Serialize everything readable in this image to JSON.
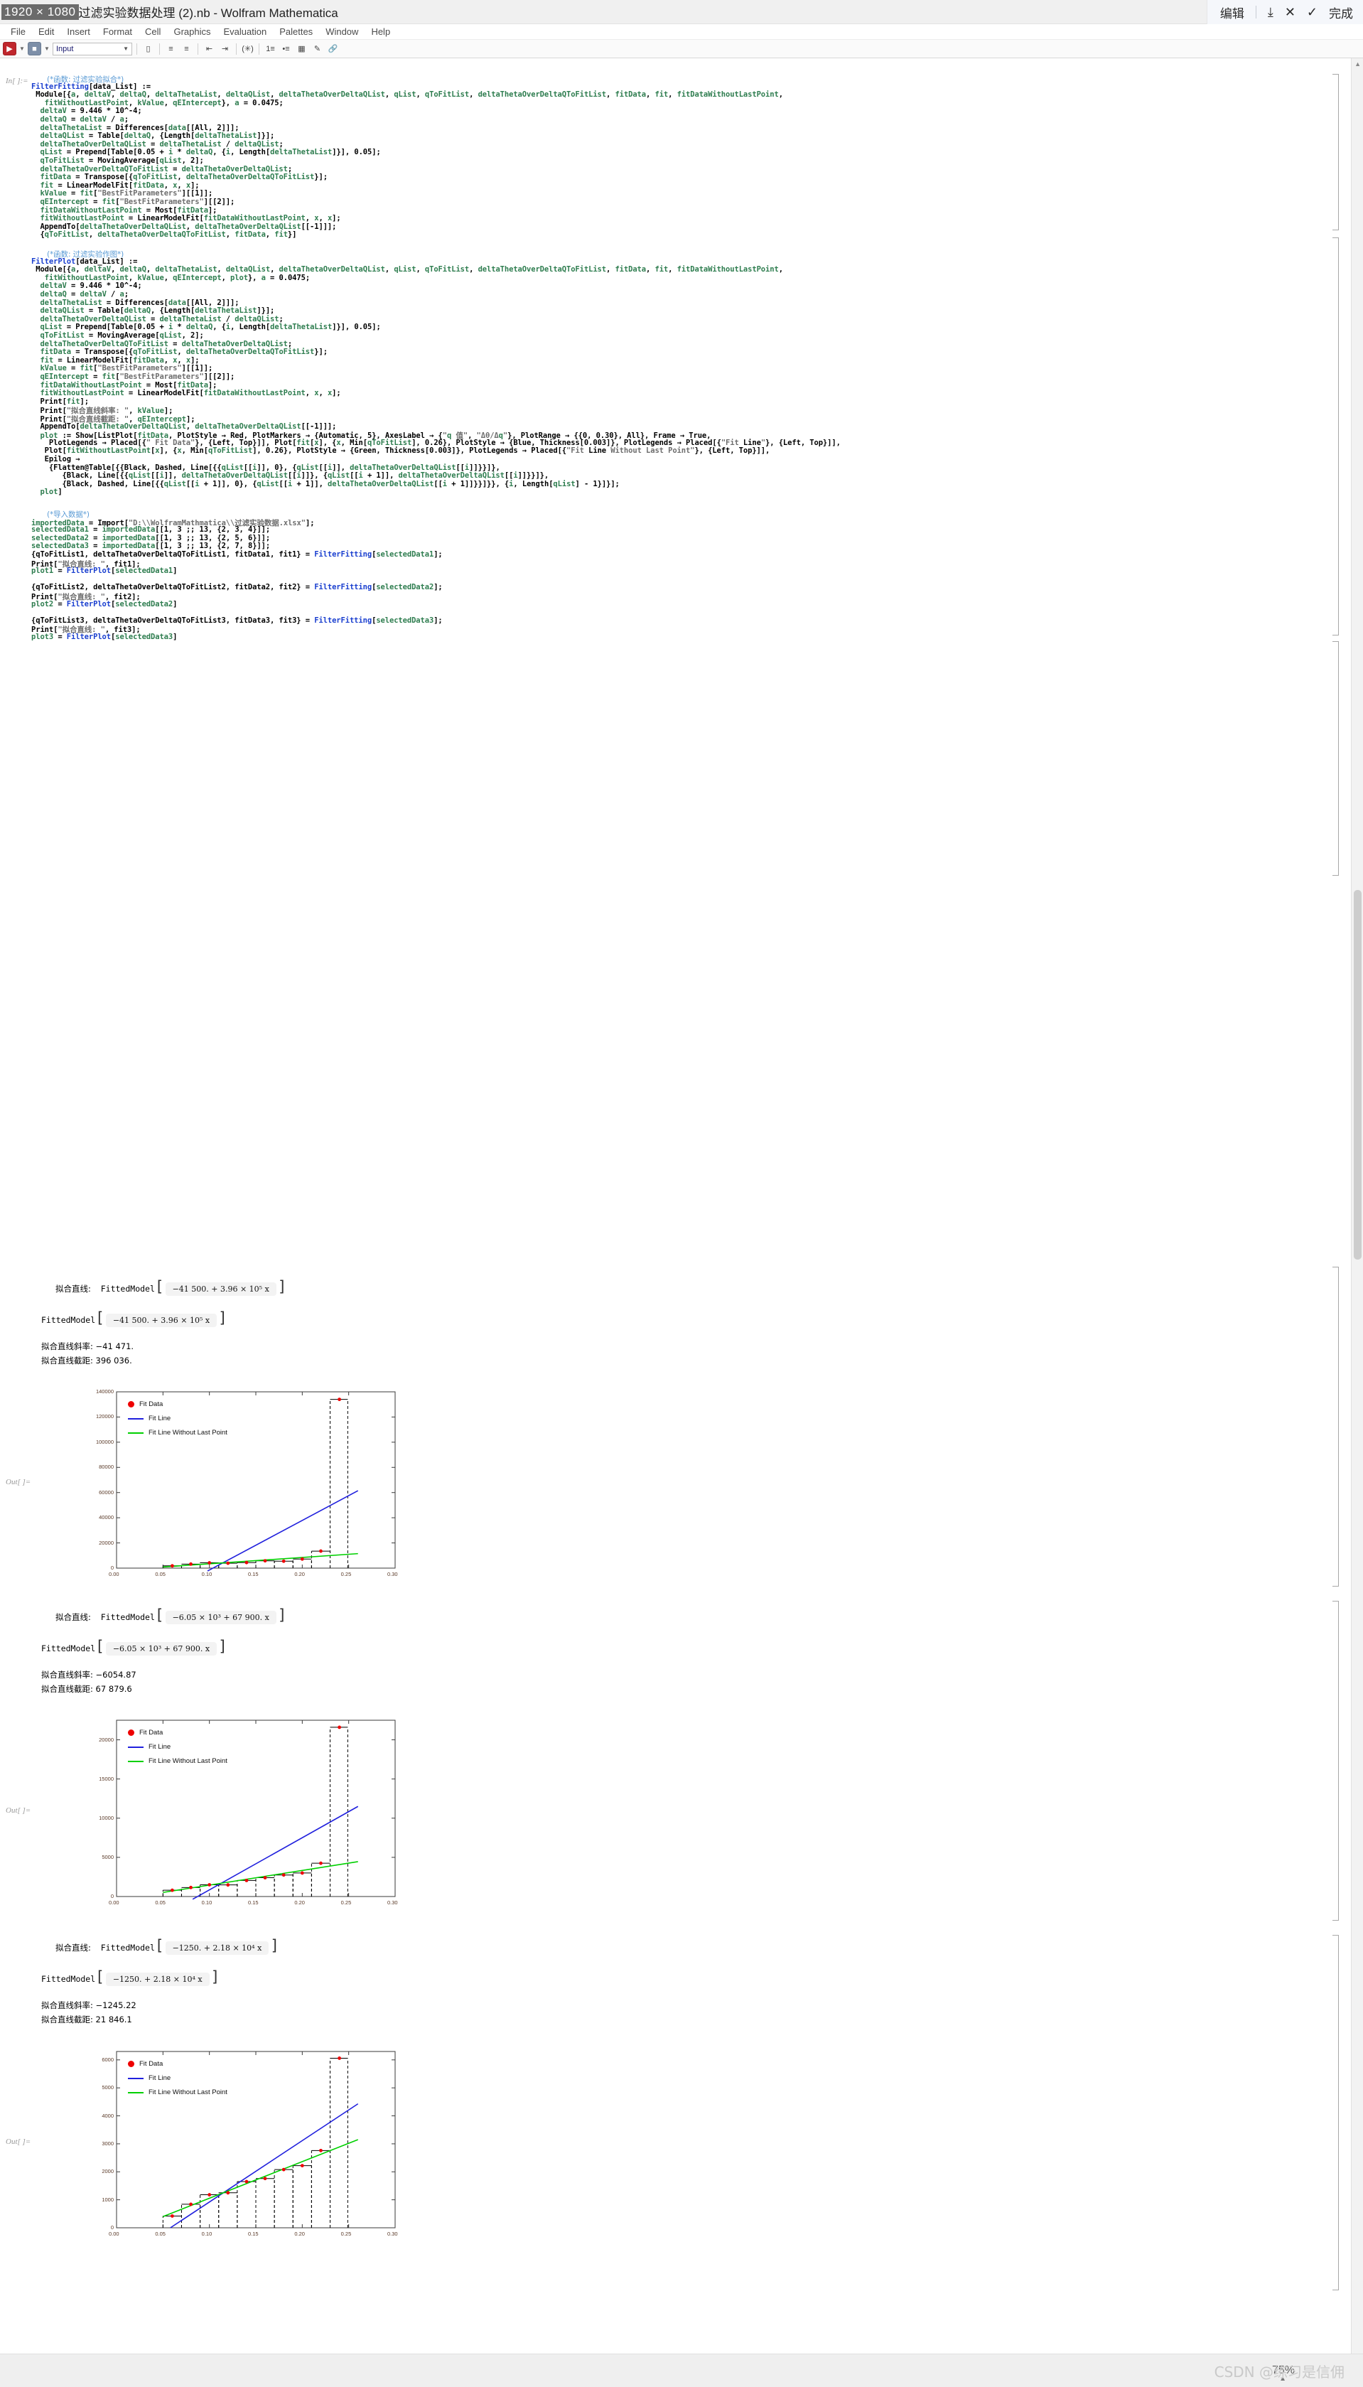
{
  "window": {
    "resolution_badge": "1920 × 1080",
    "title": "过滤实验数据处理 (2).nb - Wolfram Mathematica",
    "capture_toolbar": {
      "edit_label": "编辑",
      "save_icon": "download-icon",
      "cancel_icon": "close-x-icon",
      "check_icon": "check-icon",
      "done_label": "完成"
    }
  },
  "menubar": {
    "items": [
      {
        "label": "File",
        "accel": "F"
      },
      {
        "label": "Edit",
        "accel": "E"
      },
      {
        "label": "Insert",
        "accel": "I"
      },
      {
        "label": "Format",
        "accel": "o"
      },
      {
        "label": "Cell",
        "accel": "C"
      },
      {
        "label": "Graphics",
        "accel": "G"
      },
      {
        "label": "Evaluation",
        "accel": "v"
      },
      {
        "label": "Palettes",
        "accel": "P"
      },
      {
        "label": "Window",
        "accel": "W"
      },
      {
        "label": "Help",
        "accel": "H"
      }
    ]
  },
  "toolbar": {
    "style_value": "Input",
    "icons": [
      "run-button-icon",
      "chevron-down-icon",
      "settings-gear-icon",
      "chevron-down-icon",
      "cell-bracket-icon",
      "align-left-icon",
      "align-center-icon",
      "indent-decrease-icon",
      "indent-increase-icon",
      "math-input-icon",
      "text-format-icon",
      "bullet-list-icon",
      "numbered-list-icon",
      "color-swatch-icon",
      "pen-icon",
      "link-icon"
    ]
  },
  "notebook": {
    "cell1": {
      "in_label": "In[ ]:=",
      "comment": "(*函数: 过滤实验拟合*)",
      "lines": [
        "FilterFitting[data_List] :=",
        " Module[{a, deltaV, deltaQ, deltaThetaList, deltaQList, deltaThetaOverDeltaQList, qList, qToFitList, deltaThetaOverDeltaQToFitList, fitData, fit, fitDataWithoutLastPoint,",
        "   fitWithoutLastPoint, kValue, qEIntercept}, a = 0.0475;",
        "  deltaV = 9.446 * 10^-4;",
        "  deltaQ = deltaV / a;",
        "  deltaThetaList = Differences[data[[All, 2]]];",
        "  deltaQList = Table[deltaQ, {Length[deltaThetaList]}];",
        "  deltaThetaOverDeltaQList = deltaThetaList / deltaQList;",
        "  qList = Prepend[Table[0.05 + i * deltaQ, {i, Length[deltaThetaList]}], 0.05];",
        "  qToFitList = MovingAverage[qList, 2];",
        "  deltaThetaOverDeltaQToFitList = deltaThetaOverDeltaQList;",
        "  fitData = Transpose[{qToFitList, deltaThetaOverDeltaQToFitList}];",
        "  fit = LinearModelFit[fitData, x, x];",
        "  kValue = fit[\"BestFitParameters\"][[1]];",
        "  qEIntercept = fit[\"BestFitParameters\"][[2]];",
        "  fitDataWithoutLastPoint = Most[fitData];",
        "  fitWithoutLastPoint = LinearModelFit[fitDataWithoutLastPoint, x, x];",
        "  AppendTo[deltaThetaOverDeltaQList, deltaThetaOverDeltaQList[[-1]]];",
        "  {qToFitList, deltaThetaOverDeltaQToFitList, fitData, fit}]"
      ]
    },
    "cell2": {
      "comment": "(*函数: 过滤实验作图*)",
      "lines": [
        "FilterPlot[data_List] :=",
        " Module[{a, deltaV, deltaQ, deltaThetaList, deltaQList, deltaThetaOverDeltaQList, qList, qToFitList, deltaThetaOverDeltaQToFitList, fitData, fit, fitDataWithoutLastPoint,",
        "   fitWithoutLastPoint, kValue, qEIntercept, plot}, a = 0.0475;",
        "  deltaV = 9.446 * 10^-4;",
        "  deltaQ = deltaV / a;",
        "  deltaThetaList = Differences[data[[All, 2]]];",
        "  deltaQList = Table[deltaQ, {Length[deltaThetaList]}];",
        "  deltaThetaOverDeltaQList = deltaThetaList / deltaQList;",
        "  qList = Prepend[Table[0.05 + i * deltaQ, {i, Length[deltaThetaList]}], 0.05];",
        "  qToFitList = MovingAverage[qList, 2];",
        "  deltaThetaOverDeltaQToFitList = deltaThetaOverDeltaQList;",
        "  fitData = Transpose[{qToFitList, deltaThetaOverDeltaQToFitList}];",
        "  fit = LinearModelFit[fitData, x, x];",
        "  kValue = fit[\"BestFitParameters\"][[1]];",
        "  qEIntercept = fit[\"BestFitParameters\"][[2]];",
        "  fitDataWithoutLastPoint = Most[fitData];",
        "  fitWithoutLastPoint = LinearModelFit[fitDataWithoutLastPoint, x, x];",
        "  Print[fit];",
        "  Print[\"拟合直线斜率: \", kValue];",
        "  Print[\"拟合直线截距: \", qEIntercept];",
        "  AppendTo[deltaThetaOverDeltaQList, deltaThetaOverDeltaQList[[-1]]];",
        "  plot := Show[ListPlot[fitData, PlotStyle → Red, PlotMarkers → {Automatic, 5}, AxesLabel → {\"q 值\", \"Δθ/Δq\"}, PlotRange → {{0, 0.30}, All}, Frame → True,",
        "    PlotLegends → Placed[{\" Fit Data\"}, {Left, Top}]], Plot[fit[x], {x, Min[qToFitList], 0.26}, PlotStyle → {Blue, Thickness[0.003]}, PlotLegends → Placed[{\"Fit Line\"}, {Left, Top}]],",
        "   Plot[fitWithoutLastPoint[x], {x, Min[qToFitList], 0.26}, PlotStyle → {Green, Thickness[0.003]}, PlotLegends → Placed[{\"Fit Line Without Last Point\"}, {Left, Top}]],",
        "   Epilog →",
        "    {Flatten@Table[{{Black, Dashed, Line[{{qList[[i]], 0}, {qList[[i]], deltaThetaOverDeltaQList[[i]]}}]},",
        "       {Black, Line[{{qList[[i]], deltaThetaOverDeltaQList[[i]]}, {qList[[i + 1]], deltaThetaOverDeltaQList[[i]]}}]},",
        "       {Black, Dashed, Line[{{qList[[i + 1]], 0}, {qList[[i + 1]], deltaThetaOverDeltaQList[[i + 1]]}}]}}, {i, Length[qList] - 1}]}];",
        "  plot]"
      ]
    },
    "cell3": {
      "comment": "(*导入数据*)",
      "lines": [
        "importedData = Import[\"D:\\\\WolframMathmatica\\\\过滤实验数据.xlsx\"];",
        "selectedData1 = importedData[[1, 3 ;; 13, {2, 3, 4}]];",
        "selectedData2 = importedData[[1, 3 ;; 13, {2, 5, 6}]];",
        "selectedData3 = importedData[[1, 3 ;; 13, {2, 7, 8}]];",
        "{qToFitList1, deltaThetaOverDeltaQToFitList1, fitData1, fit1} = FilterFitting[selectedData1];",
        "Print[\"拟合直线: \", fit1];",
        "plot1 = FilterPlot[selectedData1]",
        "",
        "{qToFitList2, deltaThetaOverDeltaQToFitList2, fitData2, fit2} = FilterFitting[selectedData2];",
        "Print[\"拟合直线: \", fit2];",
        "plot2 = FilterPlot[selectedData2]",
        "",
        "{qToFitList3, deltaThetaOverDeltaQToFitList3, fitData3, fit3} = FilterFitting[selectedData3];",
        "Print[\"拟合直线: \", fit3];",
        "plot3 = FilterPlot[selectedData3]"
      ]
    }
  },
  "results": [
    {
      "print_prefix": "拟合直线:",
      "fitted_model_label": "FittedModel",
      "model_expr": "−41 500. + 3.96 × 10⁵ x",
      "fitted_model_label2": "FittedModel",
      "model_expr2": "−41 500. + 3.96 × 10⁵ x",
      "slope_label": "拟合直线斜率:",
      "slope_value": "−41 471.",
      "intercept_label": "拟合直线截距:",
      "intercept_value": "396 036.",
      "out_label": "Out[ ]="
    },
    {
      "print_prefix": "拟合直线:",
      "fitted_model_label": "FittedModel",
      "model_expr": "−6.05 × 10³ + 67 900. x",
      "fitted_model_label2": "FittedModel",
      "model_expr2": "−6.05 × 10³ + 67 900. x",
      "slope_label": "拟合直线斜率:",
      "slope_value": "−6054.87",
      "intercept_label": "拟合直线截距:",
      "intercept_value": "67 879.6",
      "out_label": "Out[ ]="
    },
    {
      "print_prefix": "拟合直线:",
      "fitted_model_label": "FittedModel",
      "model_expr": "−1250. + 2.18 × 10⁴ x",
      "fitted_model_label2": "FittedModel",
      "model_expr2": "−1250. + 2.18 × 10⁴ x",
      "slope_label": "拟合直线斜率:",
      "slope_value": "−1245.22",
      "intercept_label": "拟合直线截距:",
      "intercept_value": "21 846.1",
      "out_label": "Out[ ]="
    }
  ],
  "chart_data": [
    {
      "type": "scatter",
      "title": "",
      "xlabel": "",
      "ylabel": "",
      "xlim": [
        0.0,
        0.3
      ],
      "ylim": [
        0,
        140000
      ],
      "xticks": [
        "0.00",
        "0.05",
        "0.10",
        "0.15",
        "0.20",
        "0.25",
        "0.30"
      ],
      "xtick_values": [
        0.0,
        0.05,
        0.1,
        0.15,
        0.2,
        0.25,
        0.3
      ],
      "yticks": [
        "0",
        "20000",
        "40000",
        "60000",
        "80000",
        "100000",
        "120000",
        "140000"
      ],
      "ytick_values": [
        0,
        20000,
        40000,
        60000,
        80000,
        100000,
        120000,
        140000
      ],
      "grid": false,
      "frame": true,
      "legend_position": "left-top",
      "legend": [
        {
          "label": "Fit Data",
          "marker": "dot",
          "color": "#ee0000"
        },
        {
          "label": "Fit Line",
          "marker": "line",
          "color": "#2020dd"
        },
        {
          "label": "Fit Line Without Last Point",
          "marker": "line",
          "color": "#00d000"
        }
      ],
      "series": [
        {
          "name": "Fit Data",
          "type": "scatter",
          "color": "#ee0000",
          "x": [
            0.06,
            0.08,
            0.1,
            0.12,
            0.14,
            0.16,
            0.18,
            0.2,
            0.22,
            0.24
          ],
          "y": [
            1800,
            3200,
            4200,
            3900,
            4400,
            5800,
            5500,
            7200,
            13500,
            134000
          ]
        },
        {
          "name": "Fit Line",
          "type": "line",
          "color": "#2020dd",
          "x": [
            0.098,
            0.26
          ],
          "y": [
            -2300,
            61500
          ]
        },
        {
          "name": "Fit Line Without Last Point",
          "type": "line",
          "color": "#00d000",
          "x": [
            0.05,
            0.26
          ],
          "y": [
            900,
            11500
          ]
        }
      ],
      "step_outline": {
        "color": "#000000",
        "style": "dashed-steps",
        "qList": [
          0.05,
          0.07,
          0.09,
          0.11,
          0.13,
          0.15,
          0.17,
          0.19,
          0.21,
          0.23,
          0.249
        ],
        "levels": [
          1800,
          3200,
          4200,
          3900,
          4400,
          5800,
          5500,
          7200,
          13500,
          134000
        ]
      }
    },
    {
      "type": "scatter",
      "title": "",
      "xlabel": "",
      "ylabel": "",
      "xlim": [
        0.0,
        0.3
      ],
      "ylim": [
        0,
        22500
      ],
      "xticks": [
        "0.00",
        "0.05",
        "0.10",
        "0.15",
        "0.20",
        "0.25",
        "0.30"
      ],
      "xtick_values": [
        0.0,
        0.05,
        0.1,
        0.15,
        0.2,
        0.25,
        0.3
      ],
      "yticks": [
        "0",
        "5000",
        "10000",
        "15000",
        "20000"
      ],
      "ytick_values": [
        0,
        5000,
        10000,
        15000,
        20000
      ],
      "grid": false,
      "frame": true,
      "legend_position": "left-top",
      "legend": [
        {
          "label": "Fit Data",
          "marker": "dot",
          "color": "#ee0000"
        },
        {
          "label": "Fit Line",
          "marker": "line",
          "color": "#2020dd"
        },
        {
          "label": "Fit Line Without Last Point",
          "marker": "line",
          "color": "#00d000"
        }
      ],
      "series": [
        {
          "name": "Fit Data",
          "type": "scatter",
          "color": "#ee0000",
          "x": [
            0.06,
            0.08,
            0.1,
            0.12,
            0.14,
            0.16,
            0.18,
            0.2,
            0.22,
            0.24
          ],
          "y": [
            800,
            1150,
            1500,
            1480,
            2050,
            2400,
            2750,
            3000,
            4250,
            21600
          ]
        },
        {
          "name": "Fit Line",
          "type": "line",
          "color": "#2020dd",
          "x": [
            0.082,
            0.26
          ],
          "y": [
            -350,
            11500
          ]
        },
        {
          "name": "Fit Line Without Last Point",
          "type": "line",
          "color": "#00d000",
          "x": [
            0.05,
            0.26
          ],
          "y": [
            520,
            4450
          ]
        }
      ],
      "step_outline": {
        "color": "#000000",
        "style": "dashed-steps",
        "qList": [
          0.05,
          0.07,
          0.09,
          0.11,
          0.13,
          0.15,
          0.17,
          0.19,
          0.21,
          0.23,
          0.249
        ],
        "levels": [
          800,
          1150,
          1500,
          1480,
          2050,
          2400,
          2750,
          3000,
          4250,
          21600
        ]
      }
    },
    {
      "type": "scatter",
      "title": "",
      "xlabel": "",
      "ylabel": "",
      "xlim": [
        0.0,
        0.3
      ],
      "ylim": [
        0,
        6300
      ],
      "xticks": [
        "0.00",
        "0.05",
        "0.10",
        "0.15",
        "0.20",
        "0.25",
        "0.30"
      ],
      "xtick_values": [
        0.0,
        0.05,
        0.1,
        0.15,
        0.2,
        0.25,
        0.3
      ],
      "yticks": [
        "0",
        "1000",
        "2000",
        "3000",
        "4000",
        "5000",
        "6000"
      ],
      "ytick_values": [
        0,
        1000,
        2000,
        3000,
        4000,
        5000,
        6000
      ],
      "grid": false,
      "frame": true,
      "legend_position": "left-top",
      "legend": [
        {
          "label": "Fit Data",
          "marker": "dot",
          "color": "#ee0000"
        },
        {
          "label": "Fit Line",
          "marker": "line",
          "color": "#2020dd"
        },
        {
          "label": "Fit Line Without Last Point",
          "marker": "line",
          "color": "#00d000"
        }
      ],
      "series": [
        {
          "name": "Fit Data",
          "type": "scatter",
          "color": "#ee0000",
          "x": [
            0.06,
            0.08,
            0.1,
            0.12,
            0.14,
            0.16,
            0.18,
            0.2,
            0.22,
            0.24
          ],
          "y": [
            420,
            840,
            1180,
            1250,
            1650,
            1760,
            2080,
            2220,
            2760,
            6060
          ]
        },
        {
          "name": "Fit Line",
          "type": "line",
          "color": "#2020dd",
          "x": [
            0.058,
            0.26
          ],
          "y": [
            0,
            4430
          ]
        },
        {
          "name": "Fit Line Without Last Point",
          "type": "line",
          "color": "#00d000",
          "x": [
            0.05,
            0.26
          ],
          "y": [
            400,
            3150
          ]
        }
      ],
      "step_outline": {
        "color": "#000000",
        "style": "dashed-steps",
        "qList": [
          0.05,
          0.07,
          0.09,
          0.11,
          0.13,
          0.15,
          0.17,
          0.19,
          0.21,
          0.23,
          0.249
        ],
        "levels": [
          420,
          840,
          1180,
          1250,
          1650,
          1760,
          2080,
          2220,
          2760,
          6060
        ]
      }
    }
  ],
  "footer": {
    "watermark": "CSDN @练习是信佣",
    "zoom": "75%"
  }
}
